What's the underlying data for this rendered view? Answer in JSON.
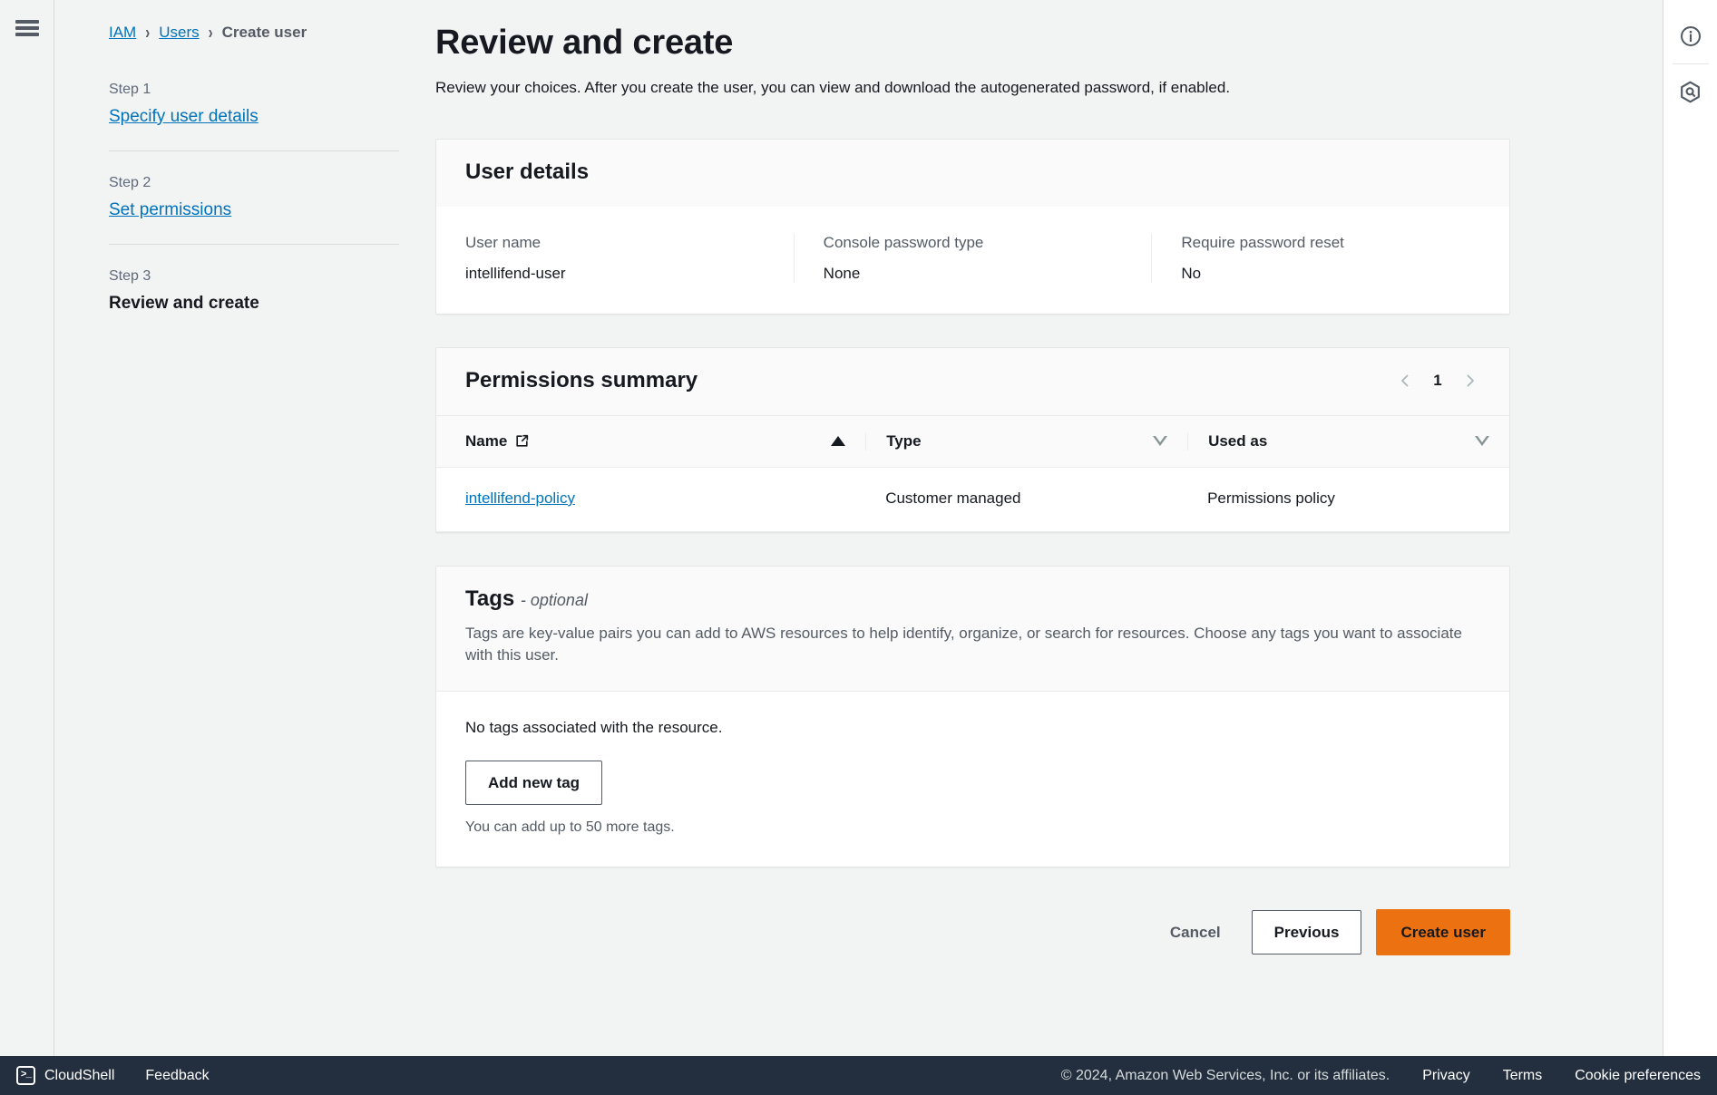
{
  "breadcrumb": {
    "items": [
      {
        "label": "IAM",
        "link": true
      },
      {
        "label": "Users",
        "link": true
      },
      {
        "label": "Create user",
        "link": false
      }
    ],
    "separator": "›"
  },
  "sidebar": {
    "steps": [
      {
        "num": "Step 1",
        "label": "Specify user details",
        "current": false
      },
      {
        "num": "Step 2",
        "label": "Set permissions",
        "current": false
      },
      {
        "num": "Step 3",
        "label": "Review and create",
        "current": true
      }
    ]
  },
  "main": {
    "title": "Review and create",
    "description": "Review your choices. After you create the user, you can view and download the autogenerated password, if enabled."
  },
  "user_details": {
    "title": "User details",
    "fields": [
      {
        "label": "User name",
        "value": "intellifend-user"
      },
      {
        "label": "Console password type",
        "value": "None"
      },
      {
        "label": "Require password reset",
        "value": "No"
      }
    ]
  },
  "permissions_summary": {
    "title": "Permissions summary",
    "pagination": {
      "prev": "‹",
      "page": "1",
      "next": "›"
    },
    "columns": [
      {
        "label": "Name",
        "sort": "asc",
        "external_link": true
      },
      {
        "label": "Type",
        "sort": "none",
        "external_link": false
      },
      {
        "label": "Used as",
        "sort": "none",
        "external_link": false
      }
    ],
    "rows": [
      {
        "name": "intellifend-policy",
        "type": "Customer managed",
        "used_as": "Permissions policy"
      }
    ]
  },
  "tags": {
    "title": "Tags",
    "optional_suffix": "- optional",
    "description": "Tags are key-value pairs you can add to AWS resources to help identify, organize, or search for resources. Choose any tags you want to associate with this user.",
    "empty_text": "No tags associated with the resource.",
    "add_button": "Add new tag",
    "hint": "You can add up to 50 more tags."
  },
  "actions": {
    "cancel": "Cancel",
    "previous": "Previous",
    "create": "Create user"
  },
  "footer": {
    "cloudshell": "CloudShell",
    "feedback": "Feedback",
    "copyright": "© 2024, Amazon Web Services, Inc. or its affiliates.",
    "privacy": "Privacy",
    "terms": "Terms",
    "cookie_preferences": "Cookie preferences"
  },
  "colors": {
    "accent_link": "#0073bb",
    "primary_button": "#ec7211",
    "page_background": "#f2f3f3",
    "footer_background": "#232f3e"
  }
}
